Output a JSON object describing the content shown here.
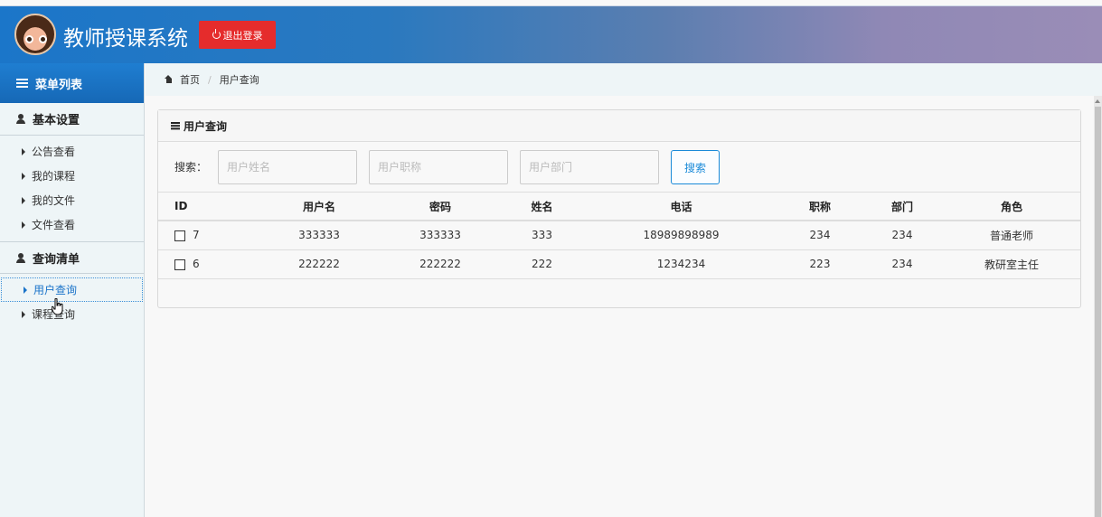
{
  "header": {
    "title": "教师授课系统",
    "logout_label": "退出登录"
  },
  "sidebar": {
    "menu_title": "菜单列表",
    "groups": [
      {
        "title": "基本设置",
        "items": [
          "公告查看",
          "我的课程",
          "我的文件",
          "文件查看"
        ]
      },
      {
        "title": "查询清单",
        "items": [
          "用户查询",
          "课程查询"
        ]
      }
    ],
    "active_item": "用户查询"
  },
  "breadcrumb": {
    "home": "首页",
    "current": "用户查询"
  },
  "panel": {
    "title": "用户查询",
    "search": {
      "label": "搜索：",
      "name_placeholder": "用户姓名",
      "title_placeholder": "用户职称",
      "dept_placeholder": "用户部门",
      "button_label": "搜索"
    },
    "table": {
      "columns": [
        "ID",
        "用户名",
        "密码",
        "姓名",
        "电话",
        "职称",
        "部门",
        "角色"
      ],
      "rows": [
        [
          "7",
          "333333",
          "333333",
          "333",
          "18989898989",
          "234",
          "234",
          "普通老师"
        ],
        [
          "6",
          "222222",
          "222222",
          "222",
          "1234234",
          "223",
          "234",
          "教研室主任"
        ]
      ]
    }
  },
  "colors": {
    "logout_button": "#e52c2c",
    "menu_header": "#1f7ed1",
    "active_link": "#1a73c9",
    "search_button": "#1a8ad8"
  }
}
